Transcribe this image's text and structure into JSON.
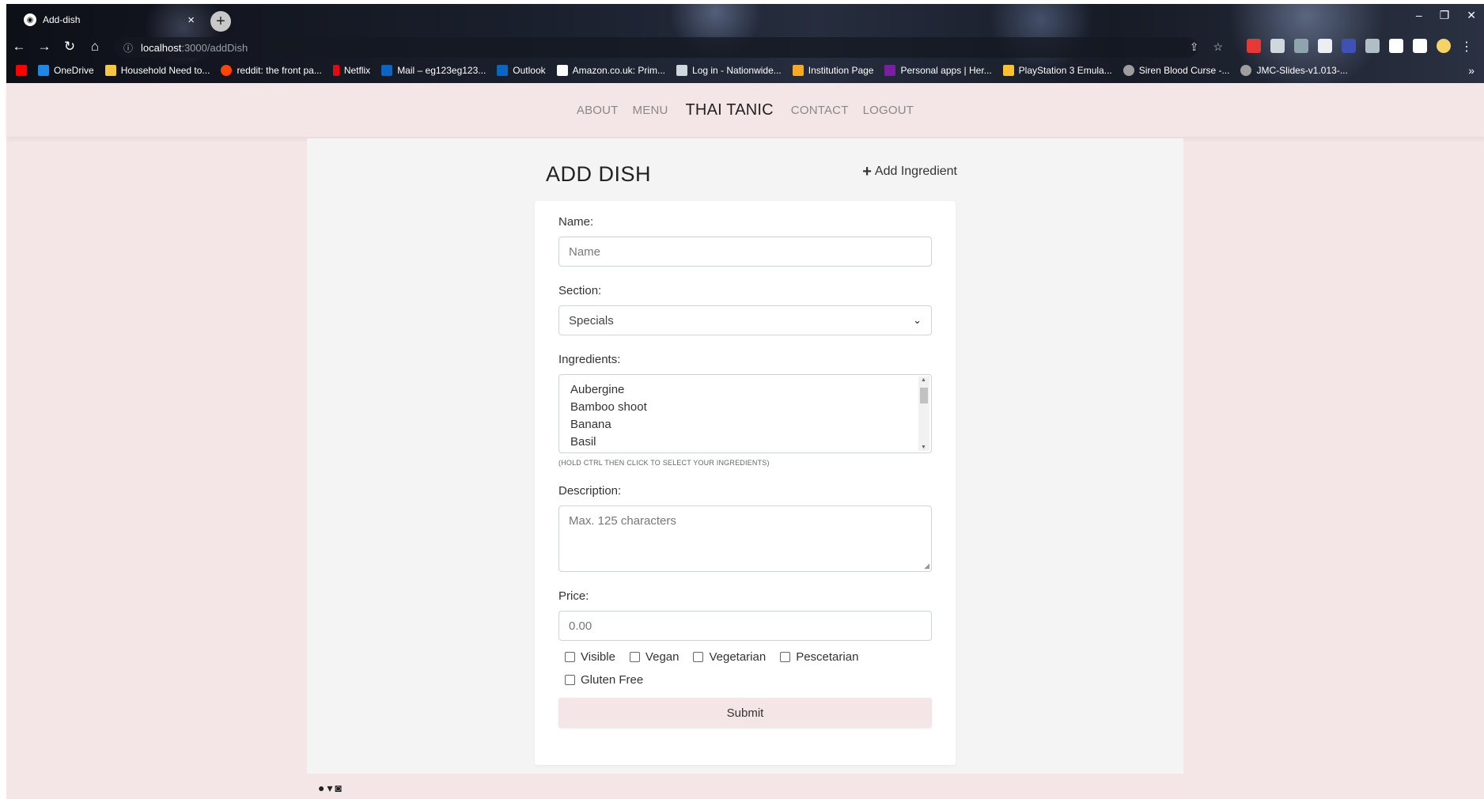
{
  "browser": {
    "tab_title": "Add-dish",
    "tab_close": "×",
    "new_tab": "+",
    "url_host": "localhost",
    "url_path": ":3000/addDish",
    "bookmarks": [
      {
        "label": "OneDrive",
        "color": "#1e88e5"
      },
      {
        "label": "Household Need to...",
        "color": "#f9c642"
      },
      {
        "label": "reddit: the front pa...",
        "color": "#ff4500"
      },
      {
        "label": "Netflix",
        "color": "#e50914"
      },
      {
        "label": "Mail – eg123eg123...",
        "color": "#0a66c2"
      },
      {
        "label": "Outlook",
        "color": "#0a66c2"
      },
      {
        "label": "Amazon.co.uk: Prim...",
        "color": "#ffffff"
      },
      {
        "label": "Log in - Nationwide...",
        "color": "#1a3d7c"
      },
      {
        "label": "Institution Page",
        "color": "#f9a825"
      },
      {
        "label": "Personal apps | Her...",
        "color": "#7b1fa2"
      },
      {
        "label": "PlayStation 3 Emula...",
        "color": "#fbc02d"
      },
      {
        "label": "Siren Blood Curse -...",
        "color": "#9e9e9e"
      },
      {
        "label": "JMC-Slides-v1.013-...",
        "color": "#9e9e9e"
      }
    ],
    "more": "»"
  },
  "nav": {
    "about": "ABOUT",
    "menu": "MENU",
    "brand": "THAI TANIC",
    "contact": "CONTACT",
    "logout": "LOGOUT"
  },
  "form": {
    "title": "ADD DISH",
    "add_ingredient": "Add Ingredient",
    "name_label": "Name:",
    "name_placeholder": "Name",
    "section_label": "Section:",
    "section_value": "Specials",
    "ingredients_label": "Ingredients:",
    "ingredients": [
      "Aubergine",
      "Bamboo shoot",
      "Banana",
      "Basil"
    ],
    "ingredients_hint": "(HOLD CTRL THEN CLICK TO SELECT YOUR INGREDIENTS)",
    "description_label": "Description:",
    "description_placeholder": "Max. 125 characters",
    "price_label": "Price:",
    "price_placeholder": "0.00",
    "options": [
      "Visible",
      "Vegan",
      "Vegetarian",
      "Pescetarian",
      "Gluten Free"
    ],
    "submit": "Submit"
  },
  "colors": {
    "page_bg": "#f4e6e6",
    "content_bg": "#f4f4f4",
    "submit_bg": "#f4e6e6"
  }
}
